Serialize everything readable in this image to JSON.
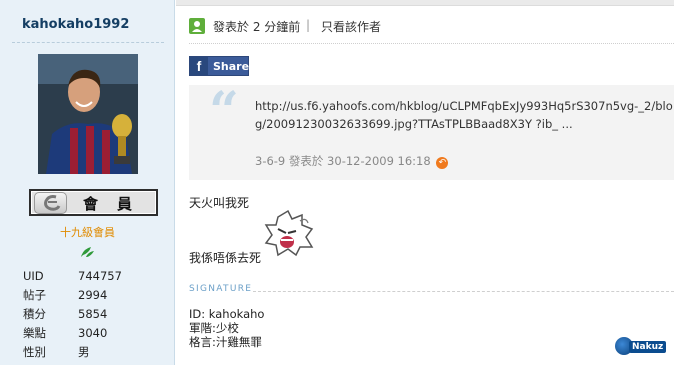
{
  "sidebar": {
    "username": "kahokaho1992",
    "badge_text": "會員",
    "rank_title": "十九級會員",
    "stats": [
      {
        "label": "UID",
        "value": "744757"
      },
      {
        "label": "帖子",
        "value": "2994"
      },
      {
        "label": "積分",
        "value": "5854"
      },
      {
        "label": "樂點",
        "value": "3040"
      },
      {
        "label": "性別",
        "value": "男"
      }
    ]
  },
  "post": {
    "posted_text": "發表於 2 分鐘前",
    "separator": "|",
    "only_author_label": "只看該作者",
    "share_label": "Share",
    "share_icon": "f",
    "quote": {
      "text": "http://us.f6.yahoofs.com/hkblog/uCLPMFqbExJy993Hq5rS307n5vg-_2/blog/20091230032633699.jpg?TTAsTPLBBaad8X3Y ?ib_ ...",
      "meta": "3-6-9 發表於 30-12-2009 16:18"
    },
    "body_line1": "天火叫我死",
    "body_line2": "我係唔係去死",
    "signature_label": "SIGNATURE",
    "signature_lines": [
      "ID: kahokaho",
      "軍階:少校",
      "格言:汁雞無罪"
    ]
  },
  "watermark": "Nakuz",
  "icons": {
    "author": "user-icon",
    "rank": "rank-leaf-icon",
    "back": "back-arrow-icon",
    "quote": "quote-mark-icon"
  },
  "colors": {
    "sidebar_bg": "#e8f1f8",
    "rank_orange": "#e08b00",
    "facebook_blue": "#3b5b99",
    "signature_blue": "#6ca0c8"
  }
}
